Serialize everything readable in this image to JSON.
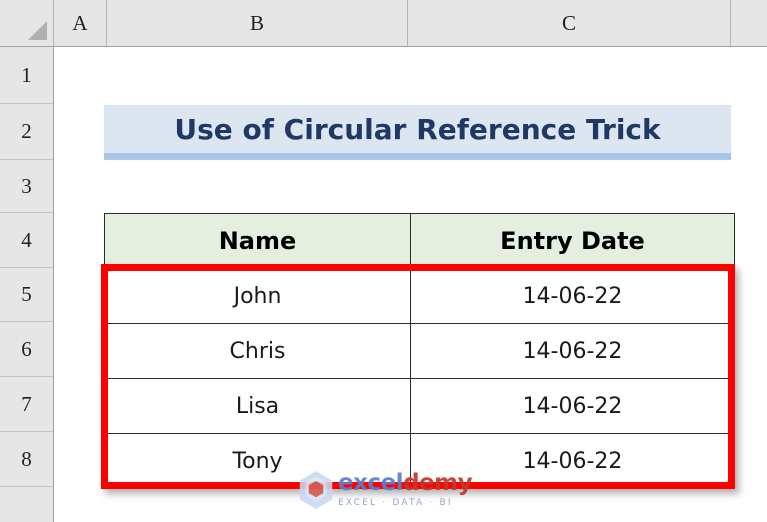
{
  "app": "excel-spreadsheet",
  "grid": {
    "column_headers": [
      "A",
      "B",
      "C"
    ],
    "row_headers": [
      "1",
      "2",
      "3",
      "4",
      "5",
      "6",
      "7",
      "8"
    ],
    "select_all_icon": "select-all-corner-icon"
  },
  "title_banner": {
    "text": "Use of Circular Reference Trick",
    "fill": "#dce6f1",
    "accent": "#a8c6e5",
    "text_color": "#1f3864"
  },
  "table": {
    "headers": [
      "Name",
      "Entry Date"
    ],
    "header_fill": "#e4efe0",
    "rows": [
      {
        "name": "John",
        "entry_date": "14-06-22"
      },
      {
        "name": "Chris",
        "entry_date": "14-06-22"
      },
      {
        "name": "Lisa",
        "entry_date": "14-06-22"
      },
      {
        "name": "Tony",
        "entry_date": "14-06-22"
      }
    ]
  },
  "highlight": {
    "color": "#ff0000",
    "name": "red-annotation-box"
  },
  "watermark": {
    "brand_first": "excel",
    "brand_second": "demy",
    "tagline": "EXCEL · DATA · BI",
    "brand_color": "#c0392b",
    "accent_color": "#5b7fc7"
  }
}
